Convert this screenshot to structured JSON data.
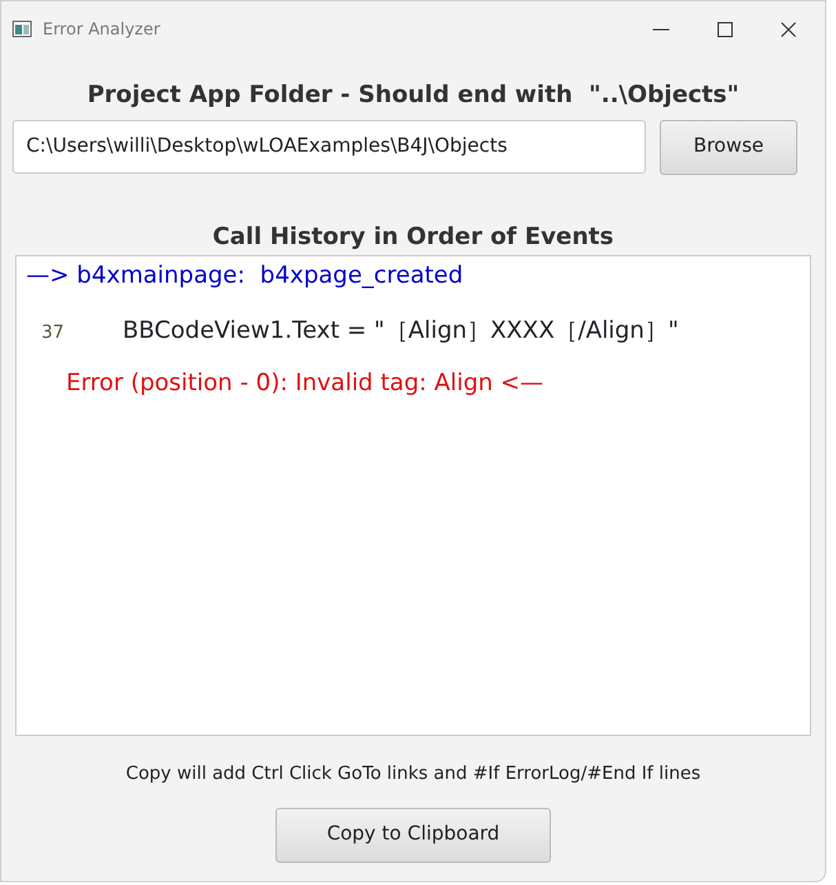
{
  "window": {
    "title": "Error Analyzer"
  },
  "folder": {
    "heading": "Project App Folder - Should end with  \"..\\Objects\"",
    "path": "C:\\Users\\willi\\Desktop\\wLOAExamples\\B4J\\Objects",
    "browse_button": "Browse"
  },
  "history": {
    "heading": "Call History in Order of Events",
    "lines": [
      {
        "kind": "header",
        "text": "—> b4xmainpage:  b4xpage_created"
      },
      {
        "kind": "code",
        "line_number": "37",
        "text": "BBCodeView1.Text = \"［Align］XXXX［/Align］\""
      },
      {
        "kind": "error",
        "text": "Error (position - 0): Invalid tag: Align <—"
      }
    ]
  },
  "footer": {
    "note": "Copy will add Ctrl Click GoTo links and #If ErrorLog/#End If lines",
    "copy_button": "Copy to Clipboard"
  }
}
